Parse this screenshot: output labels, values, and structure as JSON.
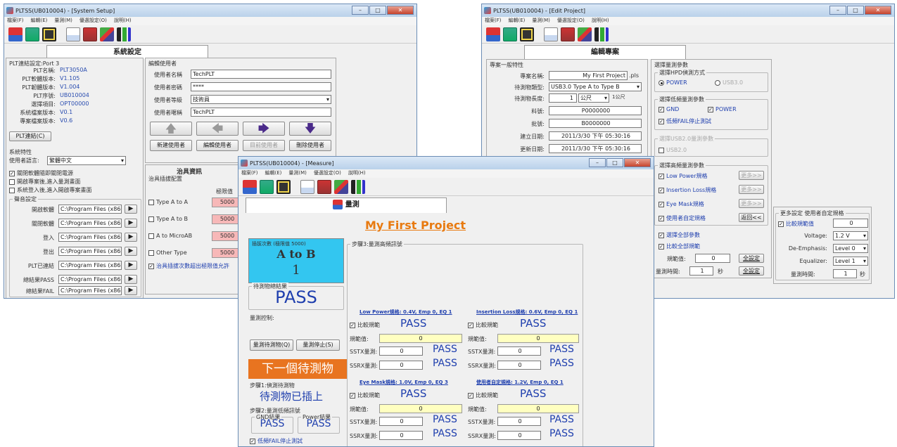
{
  "win1": {
    "title": "PLTSS(UB010004) - [System Setup]",
    "menu": [
      "檔案(F)",
      "編輯(E)",
      "量測(M)",
      "優選設定(O)",
      "說明(H)"
    ],
    "tab": "系統設定",
    "plt": {
      "header": "PLT連結設定:Port 3",
      "rows": [
        {
          "label": "PLT名稱:",
          "value": "PLT3050A"
        },
        {
          "label": "PLT軟體版本:",
          "value": "V1.105"
        },
        {
          "label": "PLT韌體版本:",
          "value": "V1.004"
        },
        {
          "label": "PLT序號:",
          "value": "UB010004"
        },
        {
          "label": "選擇項目:",
          "value": "OPT00000"
        },
        {
          "label": "系統檔案版本:",
          "value": "V0.1"
        },
        {
          "label": "專案檔案版本:",
          "value": "V0.6"
        }
      ],
      "connect_btn": "PLT連結(C)"
    },
    "sys": {
      "header": "系統特性",
      "lang_label": "使用者語言:",
      "lang_value": "繁體中文",
      "checks": [
        {
          "label": "關閉軟體隨即關閉電源",
          "checked": true
        },
        {
          "label": "開啟專案後,進入量測畫面",
          "checked": false
        },
        {
          "label": "系統登入後,進入開啟專案畫面",
          "checked": false
        }
      ]
    },
    "sound": {
      "legend": "聲音設定",
      "rows": [
        {
          "label": "開啟軟體",
          "path": "C:\\Program Files (x86)\\PL"
        },
        {
          "label": "關閉軟體",
          "path": "C:\\Program Files (x86)\\PL"
        },
        {
          "label": "登入",
          "path": "C:\\Program Files (x86)\\PL"
        },
        {
          "label": "登出",
          "path": "C:\\Program Files (x86)\\PL"
        },
        {
          "label": "PLT已連結",
          "path": "C:\\Program Files (x86)\\PL"
        },
        {
          "label": "總結果PASS",
          "path": "C:\\Program Files (x86)\\PL"
        },
        {
          "label": "總結果FAIL",
          "path": "C:\\Program Files (x86)\\PL"
        }
      ]
    },
    "user": {
      "header": "編輯使用者",
      "rows": [
        {
          "label": "使用者名稱",
          "value": "TechPLT"
        },
        {
          "label": "使用者密碼",
          "value": "****"
        },
        {
          "label": "使用者等級",
          "value": "技術員"
        },
        {
          "label": "使用者暱稱",
          "value": "TechPLT"
        }
      ],
      "buttons": [
        "新建使用者",
        "編輯使用者",
        "目前使用者",
        "刪除使用者"
      ]
    },
    "fixture": {
      "header": "治具資訊",
      "sub": "治具插拔配置",
      "col": "極限值",
      "rows": [
        {
          "label": "Type A to A",
          "value": "5000"
        },
        {
          "label": "Type A to B",
          "value": "5000"
        },
        {
          "label": "A to MicroAB",
          "value": "5000"
        },
        {
          "label": "Other Type",
          "value": "5000"
        }
      ],
      "warn": "治具插拔次數超出極限值允許"
    }
  },
  "win2": {
    "title": "PLTSS(UB010004) - [Edit Project]",
    "menu": [
      "檔案(F)",
      "編輯(E)",
      "量測(M)",
      "優選設定(O)",
      "說明(H)"
    ],
    "tab": "編輯專案",
    "general": {
      "header": "專案一般特性",
      "name_label": "專案名稱:",
      "name_value": "My First Project",
      "name_ext": ".pls",
      "type_label": "待測物類型:",
      "type_value": "USB3.0 Type A to Type B",
      "len_label": "待測物長度:",
      "len_value": "1",
      "len_unit": "公尺",
      "len_note": "1公尺",
      "part_label": "料號:",
      "part_value": "P0000000",
      "batch_label": "批號:",
      "batch_value": "B0000000",
      "created_label": "建立日期:",
      "created_value": "2011/3/30 下午 05:30:16",
      "updated_label": "更新日期:",
      "updated_value": "2011/3/30 下午 05:30:16"
    },
    "params": {
      "header": "選擇量測參數",
      "hpd_legend": "選擇HPD偵測方式",
      "hpd_opts": [
        "POWER",
        "USB3.0"
      ],
      "low_legend": "選擇低頻量測參數",
      "low_opts": [
        {
          "label": "GND",
          "checked": true
        },
        {
          "label": "POWER",
          "checked": true
        }
      ],
      "low_fail": "低頻FAIL停止測試",
      "usb2_legend": "選擇USB2.0量測參數",
      "usb2_opt": "USB2.0",
      "high_legend": "選擇高頻量測參數",
      "high_opts": [
        {
          "label": "Low Power規格",
          "btn": "更多>>"
        },
        {
          "label": "Insertion Loss規格",
          "btn": "更多>>"
        },
        {
          "label": "Eye Mask規格",
          "btn": "更多>>"
        },
        {
          "label": "使用者自定規格",
          "btn": "返回<<"
        }
      ],
      "select_all": "選擇全部參數",
      "compare_all": "比較全部規範",
      "spec_label": "規範值:",
      "spec_value": "0",
      "spec_btn": "全設定",
      "time_label": "量測時間:",
      "time_value": "1",
      "time_unit": "秒",
      "time_btn": "全設定"
    },
    "custom": {
      "legend": "更多設定 使用者自定規格",
      "check": "比較規範值",
      "check_value": "0",
      "rows": [
        {
          "label": "Voltage:",
          "value": "1.2 V"
        },
        {
          "label": "De-Emphasis:",
          "value": "Level 0"
        },
        {
          "label": "Equalizer:",
          "value": "Level 1"
        }
      ],
      "time_label": "量測時間:",
      "time_value": "1",
      "time_unit": "秒"
    }
  },
  "win3": {
    "title": "PLTSS(UB010004) - [Measure]",
    "menu": [
      "檔案(F)",
      "編輯(E)",
      "量測(M)",
      "優選設定(O)",
      "說明(H)"
    ],
    "tab": "量測",
    "project": "My First Project",
    "count_label": "插拔次數 (極限值 5000)",
    "count_type": "A to B",
    "count_value": "1",
    "result_label": "待測物總結果",
    "result": "PASS",
    "ctrl_label": "量測控制:",
    "btn_start": "量測待測物(Q)",
    "btn_stop": "量測停止(S)",
    "next": "下一個待測物",
    "step1_label": "步驟1:偵測待測物",
    "step1": "待測物已插上",
    "step2_label": "步驟2:量測低頻訊號",
    "gnd_label": "GND結果",
    "gnd": "PASS",
    "pwr_label": "Power結果",
    "pwr": "PASS",
    "lowfail": "低頻FAIL停止測試",
    "step3_label": "步驟3:量測高頻訊號",
    "blocks": [
      {
        "title": "Low Power規格: 0.4V, Emp 0, EQ 1",
        "cmp": "比較規範",
        "result": "PASS",
        "spec_label": "規範值:",
        "spec": "0",
        "sstx_label": "SSTX量測:",
        "sstx": "0",
        "sstx_res": "PASS",
        "ssrx_label": "SSRX量測:",
        "ssrx": "0",
        "ssrx_res": "PASS"
      },
      {
        "title": "Insertion Loss規格: 0.6V, Emp 0, EQ 1",
        "cmp": "比較規範",
        "result": "PASS",
        "spec_label": "規範值:",
        "spec": "0",
        "sstx_label": "SSTX量測:",
        "sstx": "0",
        "sstx_res": "PASS",
        "ssrx_label": "SSRX量測:",
        "ssrx": "0",
        "ssrx_res": "PASS"
      },
      {
        "title": "Eye Mask規格: 1.0V, Emp 0, EQ 3",
        "cmp": "比較規範",
        "result": "PASS",
        "spec_label": "規範值:",
        "spec": "0",
        "sstx_label": "SSTX量測:",
        "sstx": "0",
        "sstx_res": "PASS",
        "ssrx_label": "SSRX量測:",
        "ssrx": "0",
        "ssrx_res": "PASS"
      },
      {
        "title": "使用者自定規格: 1.2V, Emp 0, EQ 1",
        "cmp": "比較規範",
        "result": "PASS",
        "spec_label": "規範值:",
        "spec": "0",
        "sstx_label": "SSTX量測:",
        "sstx": "0",
        "sstx_res": "PASS",
        "ssrx_label": "SSRX量測:",
        "ssrx": "0",
        "ssrx_res": "PASS"
      }
    ]
  },
  "colors": {
    "accent_orange": "#e87420",
    "cyan": "#33c6f0",
    "pass_blue": "#1f3fae",
    "title_orange": "#e87a10"
  }
}
